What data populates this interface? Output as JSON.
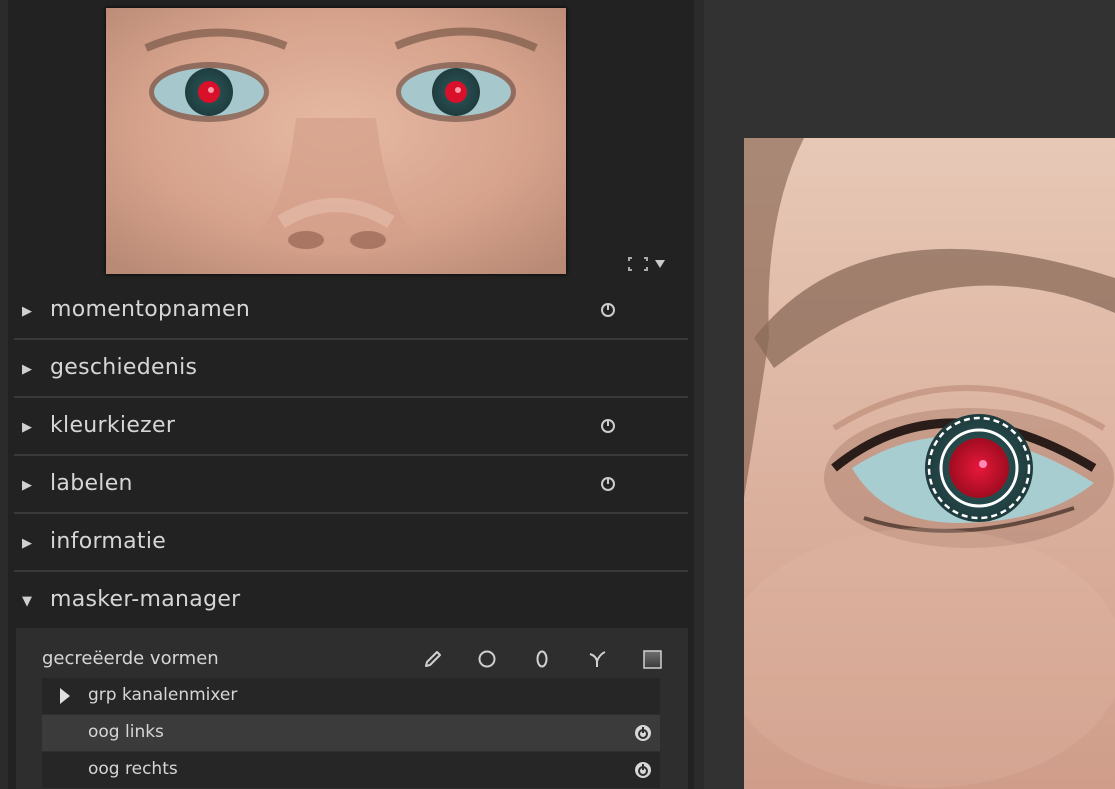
{
  "left_panel": {
    "modules": [
      {
        "label": "momentopnamen",
        "expanded": false,
        "has_power": true
      },
      {
        "label": "geschiedenis",
        "expanded": false,
        "has_power": false
      },
      {
        "label": "kleurkiezer",
        "expanded": false,
        "has_power": true
      },
      {
        "label": "labelen",
        "expanded": false,
        "has_power": true
      },
      {
        "label": "informatie",
        "expanded": false,
        "has_power": false
      },
      {
        "label": "masker-manager",
        "expanded": true,
        "has_power": false
      }
    ],
    "mask_manager": {
      "heading": "gecreëerde vormen",
      "tools": [
        "brush-icon",
        "circle-icon",
        "ellipse-icon",
        "path-icon",
        "gradient-icon"
      ],
      "rows": [
        {
          "label": "grp kanalenmixer",
          "type": "group",
          "selected": false
        },
        {
          "label": "oog links",
          "type": "shape",
          "selected": true
        },
        {
          "label": "oog rechts",
          "type": "shape",
          "selected": false
        }
      ]
    }
  },
  "colors": {
    "panel_bg": "#222222",
    "viewer_bg": "#323232",
    "text": "#d6d6d6",
    "red_eye": "#c8102e"
  }
}
